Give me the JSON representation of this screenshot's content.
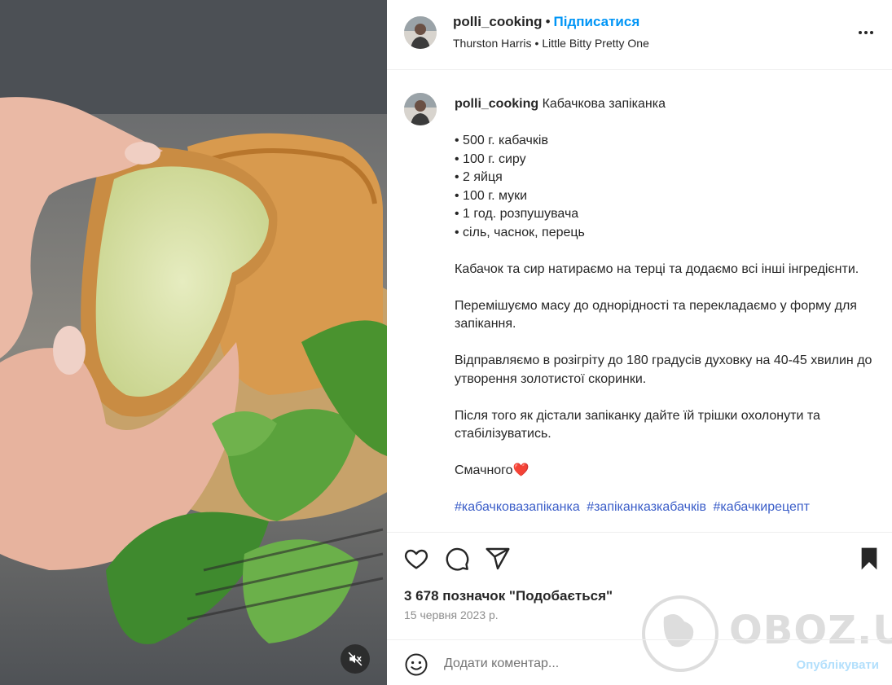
{
  "post": {
    "username": "polli_cooking",
    "separator": "•",
    "follow_label": "Підписатися",
    "music_artist": "Thurston Harris",
    "music_title": "Little Bitty Pretty One",
    "more_icon": "more-horizontal-icon"
  },
  "caption": {
    "username": "polli_cooking",
    "title": "Кабачкова запіканка",
    "ingredients": [
      "• 500 г. кабачків",
      "• 100 г. сиру",
      "• 2 яйця",
      "• 100 г. муки",
      "• 1 год. розпушувача",
      "• сіль, часнок, перець"
    ],
    "step1": "Кабачок та сир натираємо на терці та додаємо всі інші інгредієнти.",
    "step2": "Перемішуємо масу до однорідності та перекладаємо у форму для запікання.",
    "step3": "Відправляємо в розігріту до 180 градусів духовку на 40-45 хвилин до утворення золотистої скоринки.",
    "step4": "Після того як дістали запіканку дайте їй трішки охолонути та стабілізуватись.",
    "closing": "Смачного",
    "closing_emoji": "❤️",
    "hashtags": [
      "#кабачковазапіканка",
      "#запіканказкабачків",
      "#кабачкирецепт"
    ]
  },
  "stats": {
    "likes": "3 678 позначок \"Подобається\"",
    "date": "15 червня 2023 р."
  },
  "comment": {
    "placeholder": "Додати коментар...",
    "publish_label": "Опублікувати"
  },
  "watermark": {
    "text": "OBOZ.UA"
  },
  "colors": {
    "link_blue": "#0095f6",
    "hashtag_blue": "#3a5dc8",
    "publish_disabled": "#b2dffc",
    "heart_red": "#e0245e"
  }
}
